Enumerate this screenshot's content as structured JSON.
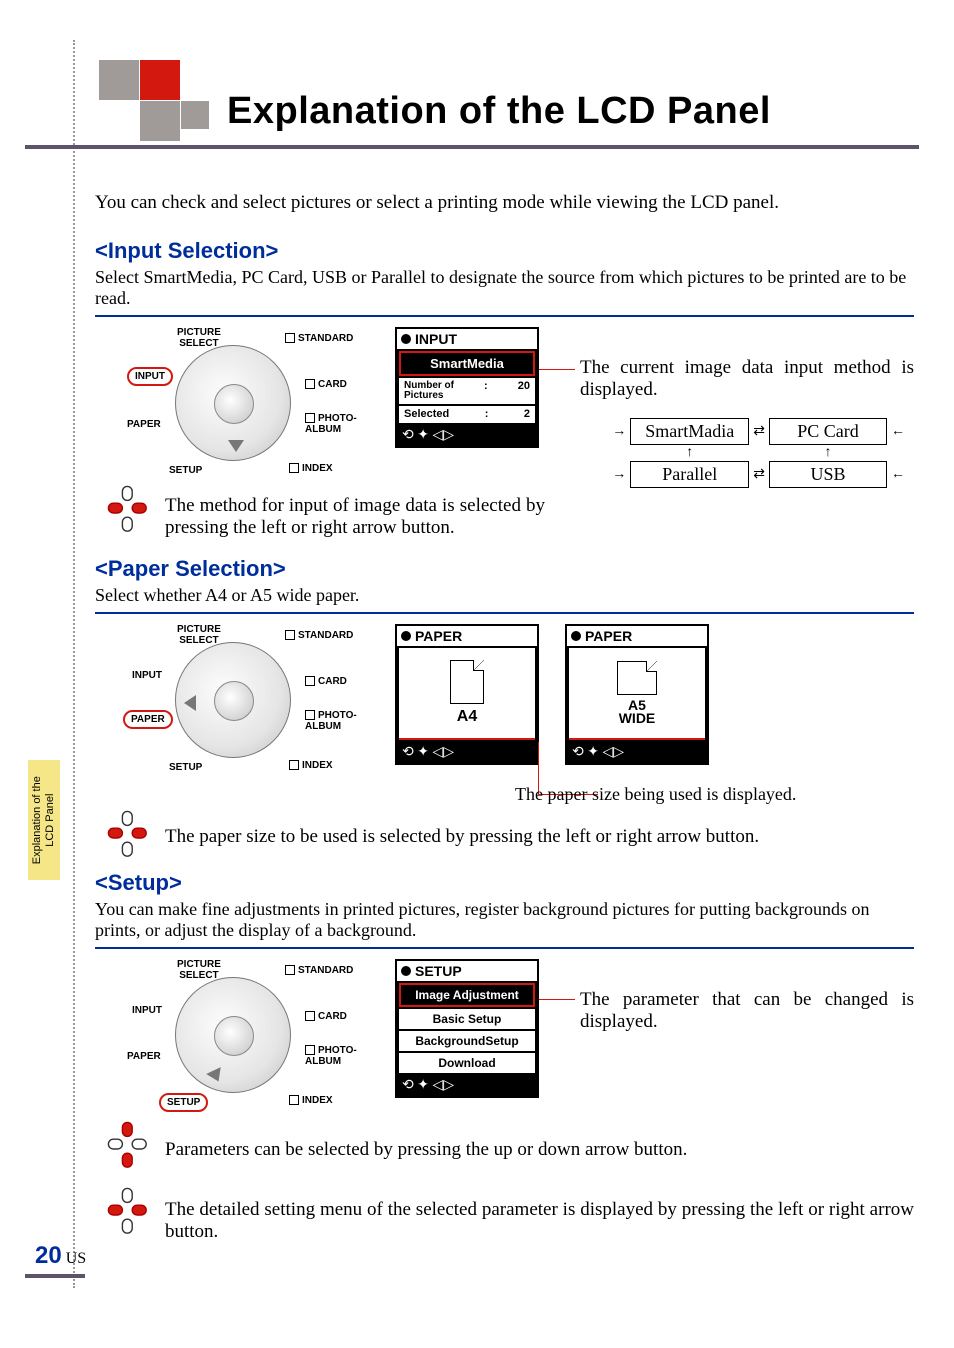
{
  "page": {
    "title": "Explanation of the LCD Panel",
    "intro": "You can check and select pictures or select a printing mode while viewing the LCD panel.",
    "side_tab_line1": "Explanation of the",
    "side_tab_line2": "LCD Panel",
    "page_number": "20",
    "region": "US"
  },
  "wheel": {
    "picture_select": "PICTURE\nSELECT",
    "input": "INPUT",
    "paper": "PAPER",
    "setup": "SETUP",
    "standard": "STANDARD",
    "card": "CARD",
    "photo_album": "PHOTO-\nALBUM",
    "index": "INDEX"
  },
  "input": {
    "heading": "<Input Selection>",
    "sub": "Select SmartMedia, PC Card, USB or Parallel to designate the source from which pictures to be printed are to be read.",
    "lcd_title": "INPUT",
    "lcd_selected": "SmartMedia",
    "lcd_row1_label": "Number of\nPictures",
    "lcd_row1_value": "20",
    "lcd_row2_label": "Selected",
    "lcd_row2_value": "2",
    "callout": "The current image data input method is displayed.",
    "note": "The method for input of image data is selected by pressing the left or right arrow button.",
    "opts": {
      "a": "SmartMadia",
      "b": "PC Card",
      "c": "Parallel",
      "d": "USB"
    }
  },
  "paper": {
    "heading": "<Paper Selection>",
    "sub": "Select whether A4 or A5 wide paper.",
    "lcd_title": "PAPER",
    "size_a": "A4",
    "size_b_line1": "A5",
    "size_b_line2": "WIDE",
    "callout": "The paper size being used is displayed.",
    "note": "The paper size to be used is selected by pressing the left or right arrow button."
  },
  "setup": {
    "heading": "<Setup>",
    "sub": "You can make fine adjustments in printed pictures, register background pictures for putting backgrounds on prints, or adjust the display of a background.",
    "lcd_title": "SETUP",
    "items": [
      "Image Adjustment",
      "Basic Setup",
      "BackgroundSetup",
      "Download"
    ],
    "callout": "The parameter that can be changed is displayed.",
    "note1": "Parameters can be selected by pressing the up or down arrow button.",
    "note2": "The detailed setting menu of the selected parameter is displayed by pressing the left or right arrow button."
  }
}
